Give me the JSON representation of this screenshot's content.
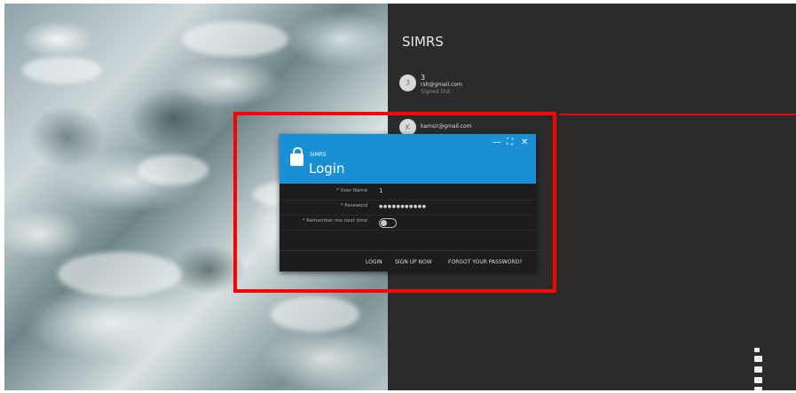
{
  "app": {
    "title": "SIMRS"
  },
  "accounts": [
    {
      "initial": "3",
      "name": "3",
      "email": "rsh@gmail.com",
      "status": "Signed Out"
    },
    {
      "initial": "K",
      "name": "",
      "email": "kamsir@gmail.com",
      "status": ""
    }
  ],
  "dialog": {
    "app_label": "SIMRS",
    "title": "Login",
    "controls": {
      "minimize": "—",
      "maximize": "⛶",
      "close": "✕"
    },
    "fields": {
      "username": {
        "label": "* User Name",
        "value": "1"
      },
      "password": {
        "label": "* Password",
        "value": "●●●●●●●●●●●"
      },
      "remember": {
        "label": "* Remember me next time",
        "checked": false
      }
    },
    "buttons": {
      "login": "LOGIN",
      "signup": "SIGN UP NOW",
      "forgot": "FORGOT YOUR PASSWORD?"
    }
  },
  "colors": {
    "accent": "#1b8fd6",
    "panel": "#2b2b2b",
    "highlight": "#ff0000"
  }
}
